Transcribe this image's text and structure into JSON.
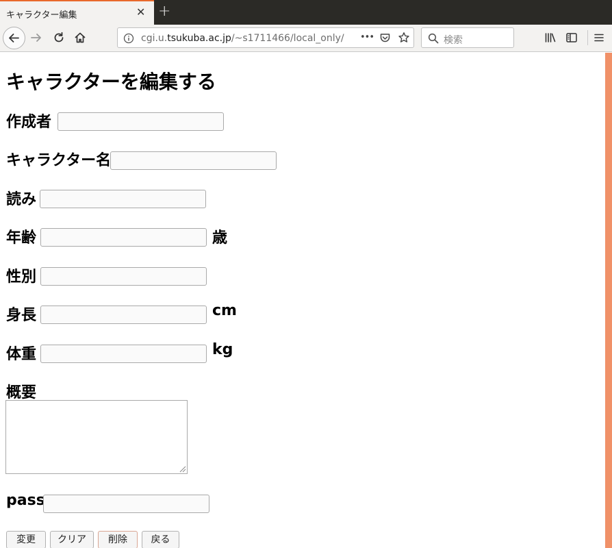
{
  "browser": {
    "tab_title": "キャラクター編集",
    "tab_close": "✕",
    "new_tab": "+",
    "url_prefix": "cgi.u.",
    "url_domain": "tsukuba.ac.jp",
    "url_path": "/~s1711466/local_only/",
    "url_dots": "•••",
    "search_placeholder": "検索"
  },
  "page": {
    "heading": "キャラクターを編集する",
    "fields": {
      "author": {
        "label": "作成者",
        "value": ""
      },
      "name": {
        "label": "キャラクター名",
        "value": ""
      },
      "reading": {
        "label": "読み",
        "value": ""
      },
      "age": {
        "label": "年齢",
        "value": "",
        "unit": "歳"
      },
      "gender": {
        "label": "性別",
        "value": ""
      },
      "height": {
        "label": "身長",
        "value": "",
        "unit": "cm"
      },
      "weight": {
        "label": "体重",
        "value": "",
        "unit": "kg"
      },
      "summary": {
        "label": "概要",
        "value": ""
      },
      "pass": {
        "label": "pass",
        "value": ""
      }
    },
    "buttons": {
      "change": "変更",
      "clear": "クリア",
      "delete": "削除",
      "back": "戻る"
    }
  },
  "colors": {
    "tab_accent": "#e9692c",
    "scroll_accent": "#f09168",
    "tabbar_bg": "#2b2a26",
    "toolbar_bg": "#f3f2f0"
  }
}
